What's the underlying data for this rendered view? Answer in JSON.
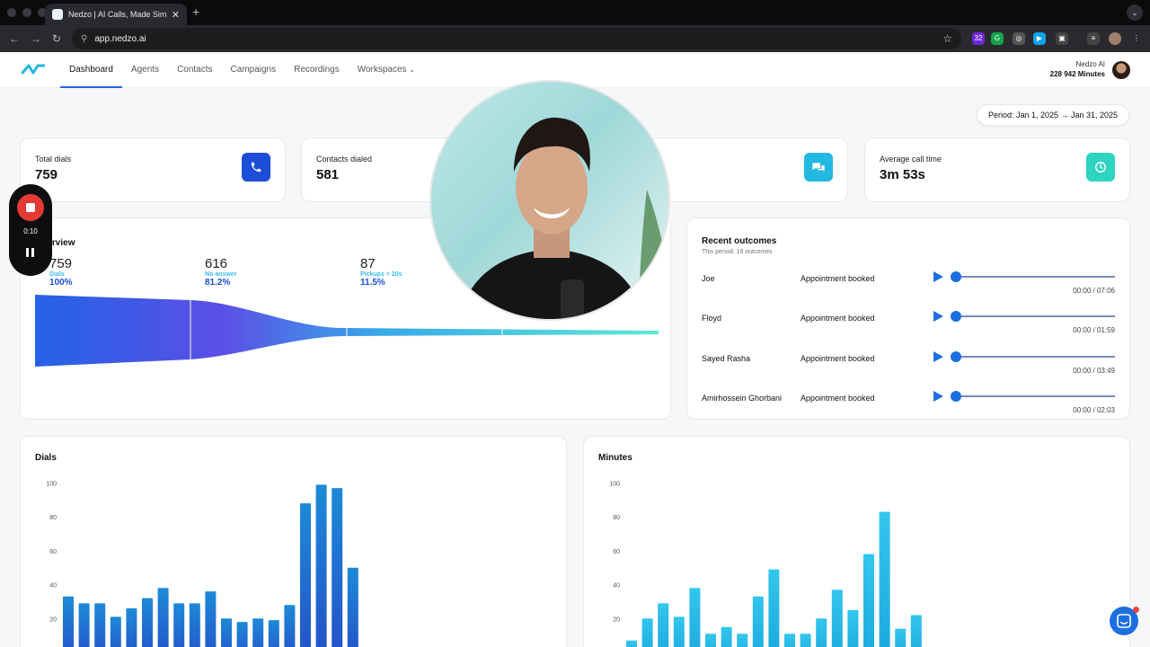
{
  "browser": {
    "tab_title": "Nedzo | AI Calls, Made Simple",
    "url": "app.nedzo.ai",
    "ext_badge": "32"
  },
  "nav": {
    "items": [
      {
        "label": "Dashboard",
        "active": true
      },
      {
        "label": "Agents"
      },
      {
        "label": "Contacts"
      },
      {
        "label": "Campaigns"
      },
      {
        "label": "Recordings"
      },
      {
        "label": "Workspaces"
      }
    ]
  },
  "account": {
    "name": "Nedzo AI",
    "minutes": "228 942 Minutes"
  },
  "period": "Period: Jan 1, 2025 → Jan 31, 2025",
  "stats": [
    {
      "label": "Total dials",
      "value": "759",
      "icon": "phone-icon",
      "color": "#1d4ed8"
    },
    {
      "label": "Contacts dialed",
      "value": "581",
      "icon": "users-icon",
      "color": "#2563eb"
    },
    {
      "label": "",
      "value": "",
      "icon": "chat-icon",
      "color": "#22b8e0"
    },
    {
      "label": "Average call time",
      "value": "3m 53s",
      "icon": "clock-icon",
      "color": "#2dd4bf"
    }
  ],
  "overview": {
    "title": "Overview",
    "funnel": [
      {
        "num": "759",
        "label": "Dials",
        "pct": "100%"
      },
      {
        "num": "616",
        "label": "No answer",
        "pct": "81.2%"
      },
      {
        "num": "87",
        "label": "Pickups > 20s",
        "pct": "11.5%"
      }
    ]
  },
  "recent": {
    "title": "Recent outcomes",
    "subtitle": "This period: 19 outcomes",
    "rows": [
      {
        "name": "Joe",
        "outcome": "Appointment booked",
        "time": "00:00 / 07:06"
      },
      {
        "name": "Floyd",
        "outcome": "Appointment booked",
        "time": "00:00 / 01:59"
      },
      {
        "name": "Sayed Rasha",
        "outcome": "Appointment booked",
        "time": "00:00 / 03:49"
      },
      {
        "name": "Amirhossein Ghorbani",
        "outcome": "Appointment booked",
        "time": "00:00 / 02:03"
      }
    ]
  },
  "recorder": {
    "time": "0:10"
  },
  "chart_data": [
    {
      "type": "bar",
      "title": "Dials",
      "ylim": [
        0,
        100
      ],
      "yticks": [
        20,
        40,
        60,
        80,
        100
      ],
      "values": [
        33,
        29,
        29,
        21,
        26,
        32,
        38,
        29,
        29,
        36,
        20,
        18,
        20,
        19,
        28,
        88,
        99,
        97,
        50
      ],
      "color_top": "#1d8ad8",
      "color_bottom": "#2450c8"
    },
    {
      "type": "bar",
      "title": "Minutes",
      "ylim": [
        0,
        100
      ],
      "yticks": [
        20,
        40,
        60,
        80,
        100
      ],
      "values": [
        7,
        20,
        29,
        21,
        38,
        11,
        15,
        11,
        33,
        49,
        11,
        11,
        20,
        37,
        25,
        58,
        83,
        14,
        22
      ],
      "color_top": "#33c6ee",
      "color_bottom": "#1aa7dc"
    }
  ]
}
